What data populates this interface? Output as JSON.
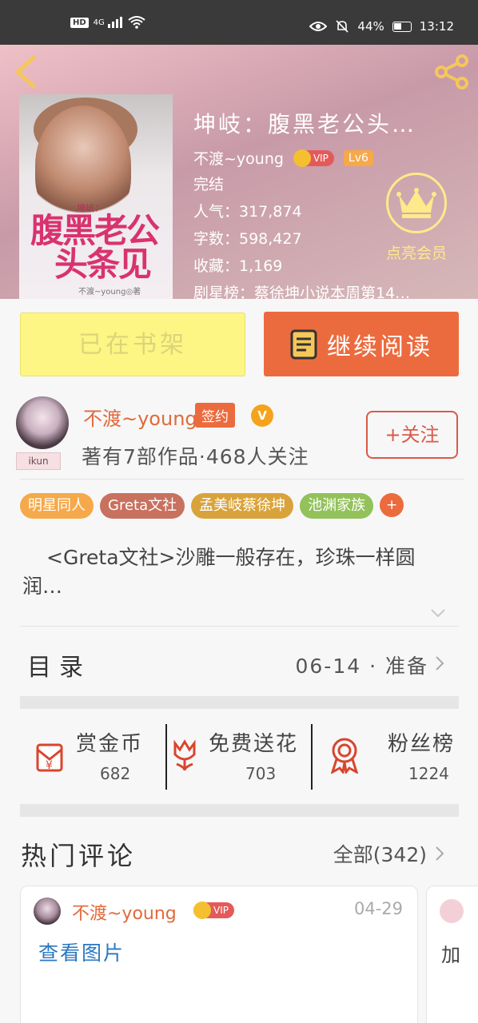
{
  "status_bar": {
    "hd": "HD",
    "network": "4G",
    "battery": "44%",
    "time": "13:12"
  },
  "book": {
    "title": "坤岐：腹黑老公头…",
    "author": "不渡~young",
    "vip": "VIP",
    "level": "Lv6",
    "status": "完结",
    "popularity": "人气：317,874",
    "word_count": "字数：598,427",
    "favorites": "收藏：1,169",
    "ranking": "剧星榜：蔡徐坤小说本周第14…"
  },
  "cover": {
    "subtitle": "坤岐：",
    "title_line1": "腹黑老公",
    "title_line2": "头条见",
    "author": "不渡~young◎著"
  },
  "member": {
    "label": "点亮会员"
  },
  "actions": {
    "shelf_label": "已在书架",
    "read_label": "继续阅读"
  },
  "author_card": {
    "avatar_tag": "ikun",
    "name": "不渡~young",
    "sign_badge": "签约",
    "v_badge": "V",
    "stats": "著有7部作品·468人关注",
    "follow_label": "+关注"
  },
  "tags": [
    {
      "label": "明星同人",
      "color": "#f5a94a"
    },
    {
      "label": "Greta文社",
      "color": "#c8715e"
    },
    {
      "label": "孟美岐蔡徐坤",
      "color": "#d9a33b"
    },
    {
      "label": "池渊家族",
      "color": "#93c15a"
    }
  ],
  "tag_more": "+",
  "description": "<Greta文社>沙雕一般存在，珍珠一样圆润…",
  "catalog": {
    "label": "目录",
    "latest": "06-14 · 准备"
  },
  "stats": [
    {
      "name": "赏金币",
      "value": "682",
      "icon": "gift-coin-icon"
    },
    {
      "name": "免费送花",
      "value": "703",
      "icon": "flower-icon"
    },
    {
      "name": "粉丝榜",
      "value": "1224",
      "icon": "medal-icon"
    }
  ],
  "comments": {
    "title": "热门评论",
    "all_label": "全部(342)",
    "items": [
      {
        "user": "不渡~young",
        "vip": "VIP",
        "date": "04-29",
        "content": "查看图片"
      },
      {
        "content": "加"
      }
    ]
  },
  "colors": {
    "accent": "#ec6b3e",
    "shelf": "#fdf584",
    "link": "#2a78c2",
    "member_gold": "#ffe98a"
  }
}
